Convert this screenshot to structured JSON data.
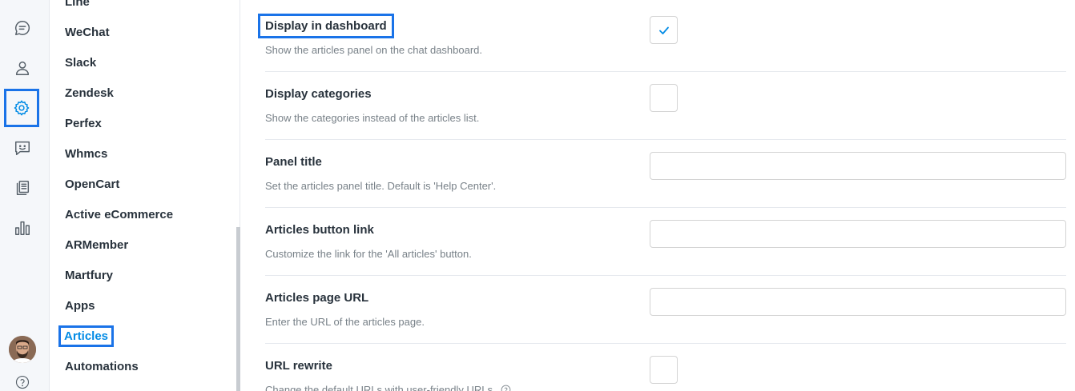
{
  "rail": {
    "icons": [
      {
        "name": "conversations-icon"
      },
      {
        "name": "users-icon"
      },
      {
        "name": "settings-icon",
        "active": true
      },
      {
        "name": "chatbot-icon"
      },
      {
        "name": "articles-icon"
      },
      {
        "name": "reports-icon"
      }
    ],
    "accent": "#028be5"
  },
  "nav": {
    "items": [
      {
        "label": "Line"
      },
      {
        "label": "WeChat"
      },
      {
        "label": "Slack"
      },
      {
        "label": "Zendesk"
      },
      {
        "label": "Perfex"
      },
      {
        "label": "Whmcs"
      },
      {
        "label": "OpenCart"
      },
      {
        "label": "Active eCommerce"
      },
      {
        "label": "ARMember"
      },
      {
        "label": "Martfury"
      },
      {
        "label": "Apps"
      },
      {
        "label": "Articles",
        "active": true
      },
      {
        "label": "Automations"
      }
    ]
  },
  "settings": [
    {
      "title": "Display in dashboard",
      "desc": "Show the articles panel on the chat dashboard.",
      "control": "checkbox",
      "checked": true
    },
    {
      "title": "Display categories",
      "desc": "Show the categories instead of the articles list.",
      "control": "checkbox",
      "checked": false
    },
    {
      "title": "Panel title",
      "desc": "Set the articles panel title. Default is 'Help Center'.",
      "control": "input",
      "value": ""
    },
    {
      "title": "Articles button link",
      "desc": "Customize the link for the 'All articles' button.",
      "control": "input",
      "value": ""
    },
    {
      "title": "Articles page URL",
      "desc": "Enter the URL of the articles page.",
      "control": "input",
      "value": ""
    },
    {
      "title": "URL rewrite",
      "desc": "Change the default URLs with user-friendly URLs.",
      "control": "checkbox",
      "checked": false
    }
  ]
}
